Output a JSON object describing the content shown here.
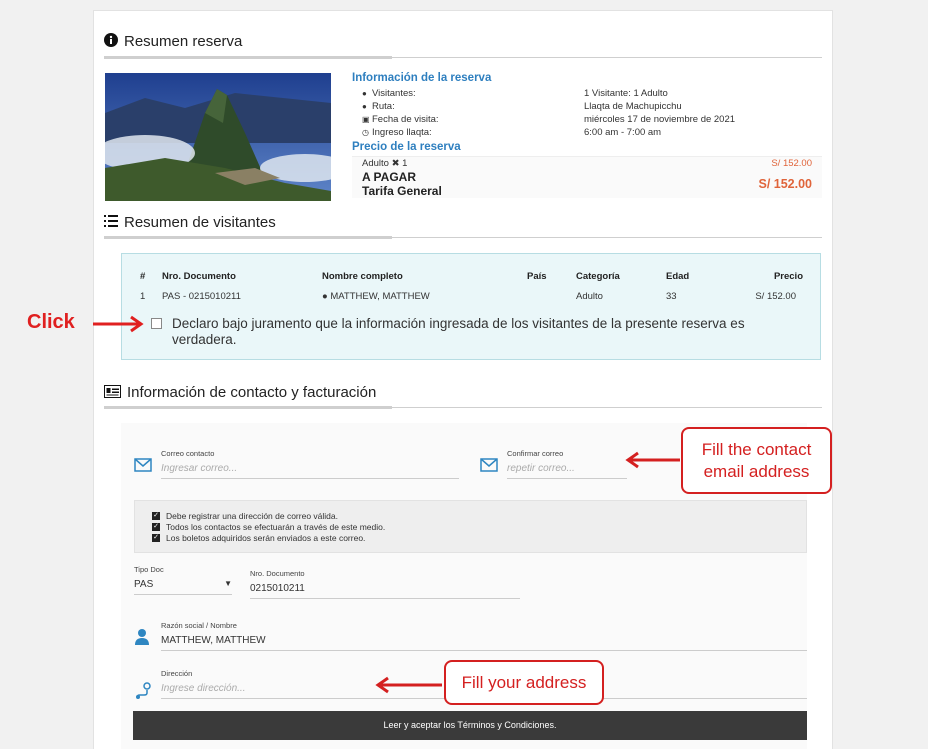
{
  "summary": {
    "title": "Resumen reserva",
    "info_header": "Información de la reserva",
    "rows": [
      {
        "label": "Visitantes:",
        "icon": "users-icon",
        "value": "1 Visitante: 1 Adulto"
      },
      {
        "label": "Ruta:",
        "icon": "route-icon",
        "value": "Llaqta de Machupicchu"
      },
      {
        "label": "Fecha de visita:",
        "icon": "calendar-icon",
        "value": "miércoles 17 de noviembre de 2021"
      },
      {
        "label": "Ingreso llaqta:",
        "icon": "clock-icon",
        "value": "6:00 am - 7:00 am"
      }
    ],
    "price_header": "Precio de la reserva",
    "price_line_label": "Adulto ✖ 1",
    "price_line_value": "S/ 152.00",
    "to_pay_label_1": "A PAGAR",
    "to_pay_label_2": "Tarifa General",
    "to_pay_value": "S/ 152.00"
  },
  "visitors": {
    "title": "Resumen de visitantes",
    "columns": [
      "#",
      "Nro. Documento",
      "Nombre completo",
      "País",
      "Categoría",
      "Edad",
      "Precio"
    ],
    "row": {
      "n": "1",
      "doc": "PAS - 0215010211",
      "name": "MATTHEW, MATTHEW",
      "country": "",
      "category": "Adulto",
      "age": "33",
      "price": "S/ 152.00"
    },
    "declaration": "Declaro bajo juramento que la información ingresada de los visitantes de la presente reserva es verdadera."
  },
  "contact": {
    "title": "Información de contacto y facturación",
    "email_label": "Correo contacto",
    "email_placeholder": "Ingresar correo...",
    "confirm_label": "Confirmar correo",
    "confirm_placeholder": "repetir correo...",
    "notes": [
      "Debe registrar una dirección de correo válida.",
      "Todos los contactos se efectuarán a través de este medio.",
      "Los boletos adquiridos serán enviados a este correo."
    ],
    "doc_type_label": "Tipo Doc",
    "doc_type_value": "PAS",
    "doc_number_label": "Nro. Documento",
    "doc_number_value": "0215010211",
    "business_label": "Razón social / Nombre",
    "business_value": "MATTHEW, MATTHEW",
    "address_label": "Dirección",
    "address_placeholder": "Ingrese dirección...",
    "terms_button": "Leer y aceptar los Términos y Condiciones."
  },
  "annotations": {
    "click": "Click",
    "email_callout_1": "Fill the contact",
    "email_callout_2": "email address",
    "address_callout": "Fill your address",
    "color": "#d42020"
  }
}
